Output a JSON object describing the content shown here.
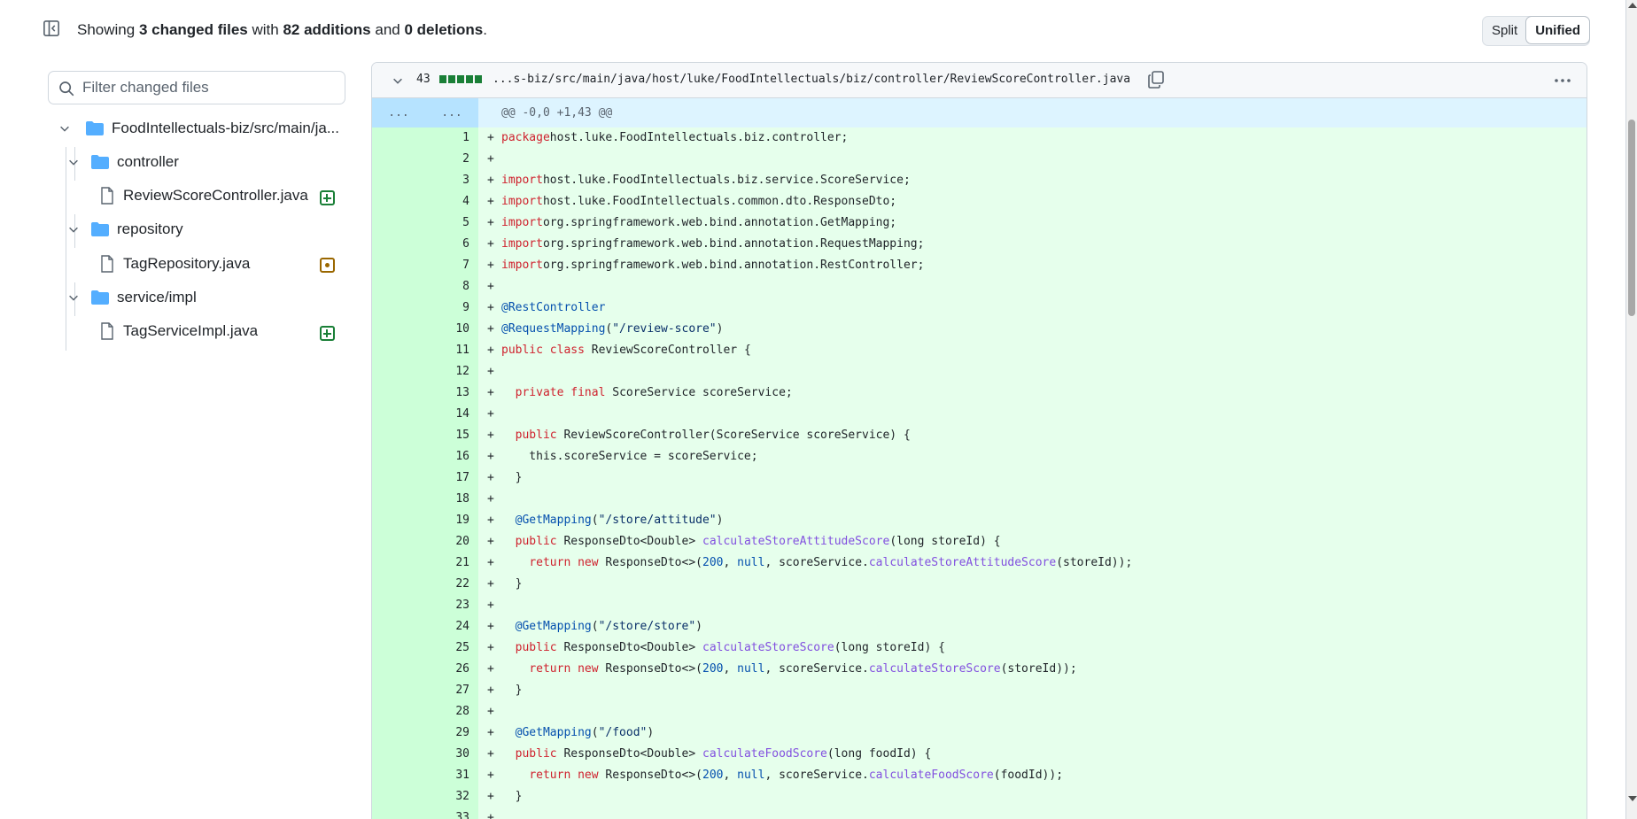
{
  "header": {
    "summary_prefix": "Showing ",
    "files_changed": "3 changed files",
    "summary_with": " with ",
    "additions": "82 additions",
    "summary_and": " and ",
    "deletions": "0 deletions",
    "summary_end": ".",
    "view_split": "Split",
    "view_unified": "Unified",
    "active_view": "Unified"
  },
  "sidebar": {
    "filter_placeholder": "Filter changed files",
    "root_folder": "FoodIntellectuals-biz/src/main/ja...",
    "folders": [
      {
        "name": "controller",
        "files": [
          {
            "name": "ReviewScoreController.java",
            "status": "added"
          }
        ]
      },
      {
        "name": "repository",
        "files": [
          {
            "name": "TagRepository.java",
            "status": "modified"
          }
        ]
      },
      {
        "name": "service/impl",
        "files": [
          {
            "name": "TagServiceImpl.java",
            "status": "added"
          }
        ]
      }
    ]
  },
  "file": {
    "change_count": "43",
    "path": "...s-biz/src/main/java/host/luke/FoodIntellectuals/biz/controller/ReviewScoreController.java",
    "hunk_left": "...",
    "hunk_right": "...",
    "hunk_header": "@@ -0,0 +1,43 @@"
  },
  "code_lines": [
    [
      [
        "k",
        "package"
      ],
      [
        "",
        "host.luke.FoodIntellectuals.biz.controller;"
      ]
    ],
    [],
    [
      [
        "k",
        "import"
      ],
      [
        "",
        "host.luke.FoodIntellectuals.biz.service.ScoreService;"
      ]
    ],
    [
      [
        "k",
        "import"
      ],
      [
        "",
        "host.luke.FoodIntellectuals.common.dto.ResponseDto;"
      ]
    ],
    [
      [
        "k",
        "import"
      ],
      [
        "",
        "org.springframework.web.bind.annotation.GetMapping;"
      ]
    ],
    [
      [
        "k",
        "import"
      ],
      [
        "",
        "org.springframework.web.bind.annotation.RequestMapping;"
      ]
    ],
    [
      [
        "k",
        "import"
      ],
      [
        "",
        "org.springframework.web.bind.annotation.RestController;"
      ]
    ],
    [],
    [
      [
        "a",
        "@RestController"
      ]
    ],
    [
      [
        "a",
        "@RequestMapping"
      ],
      [
        "",
        "("
      ],
      [
        "s",
        "\"/review-score\""
      ],
      [
        "",
        ")"
      ]
    ],
    [
      [
        "k",
        "public"
      ],
      [
        "",
        " "
      ],
      [
        "k",
        "class"
      ],
      [
        "",
        " ReviewScoreController {"
      ]
    ],
    [],
    [
      [
        "",
        "  "
      ],
      [
        "k",
        "private"
      ],
      [
        "",
        " "
      ],
      [
        "k",
        "final"
      ],
      [
        "",
        " ScoreService scoreService;"
      ]
    ],
    [],
    [
      [
        "",
        "  "
      ],
      [
        "k",
        "public"
      ],
      [
        "",
        " ReviewScoreController(ScoreService scoreService) {"
      ]
    ],
    [
      [
        "",
        "    this.scoreService = scoreService;"
      ]
    ],
    [
      [
        "",
        "  }"
      ]
    ],
    [],
    [
      [
        "",
        "  "
      ],
      [
        "a",
        "@GetMapping"
      ],
      [
        "",
        "("
      ],
      [
        "s",
        "\"/store/attitude\""
      ],
      [
        "",
        ")"
      ]
    ],
    [
      [
        "",
        "  "
      ],
      [
        "k",
        "public"
      ],
      [
        "",
        " ResponseDto<Double> "
      ],
      [
        "f",
        "calculateStoreAttitudeScore"
      ],
      [
        "",
        "(long storeId) {"
      ]
    ],
    [
      [
        "",
        "    "
      ],
      [
        "k",
        "return"
      ],
      [
        "",
        " "
      ],
      [
        "k",
        "new"
      ],
      [
        "",
        " ResponseDto<>("
      ],
      [
        "a",
        "200"
      ],
      [
        "",
        ", "
      ],
      [
        "a",
        "null"
      ],
      [
        "",
        ", scoreService."
      ],
      [
        "f",
        "calculateStoreAttitudeScore"
      ],
      [
        "",
        "(storeId));"
      ]
    ],
    [
      [
        "",
        "  }"
      ]
    ],
    [],
    [
      [
        "",
        "  "
      ],
      [
        "a",
        "@GetMapping"
      ],
      [
        "",
        "("
      ],
      [
        "s",
        "\"/store/store\""
      ],
      [
        "",
        ")"
      ]
    ],
    [
      [
        "",
        "  "
      ],
      [
        "k",
        "public"
      ],
      [
        "",
        " ResponseDto<Double> "
      ],
      [
        "f",
        "calculateStoreScore"
      ],
      [
        "",
        "(long storeId) {"
      ]
    ],
    [
      [
        "",
        "    "
      ],
      [
        "k",
        "return"
      ],
      [
        "",
        " "
      ],
      [
        "k",
        "new"
      ],
      [
        "",
        " ResponseDto<>("
      ],
      [
        "a",
        "200"
      ],
      [
        "",
        ", "
      ],
      [
        "a",
        "null"
      ],
      [
        "",
        ", scoreService."
      ],
      [
        "f",
        "calculateStoreScore"
      ],
      [
        "",
        "(storeId));"
      ]
    ],
    [
      [
        "",
        "  }"
      ]
    ],
    [],
    [
      [
        "",
        "  "
      ],
      [
        "a",
        "@GetMapping"
      ],
      [
        "",
        "("
      ],
      [
        "s",
        "\"/food\""
      ],
      [
        "",
        ")"
      ]
    ],
    [
      [
        "",
        "  "
      ],
      [
        "k",
        "public"
      ],
      [
        "",
        " ResponseDto<Double> "
      ],
      [
        "f",
        "calculateFoodScore"
      ],
      [
        "",
        "(long foodId) {"
      ]
    ],
    [
      [
        "",
        "    "
      ],
      [
        "k",
        "return"
      ],
      [
        "",
        " "
      ],
      [
        "k",
        "new"
      ],
      [
        "",
        " ResponseDto<>("
      ],
      [
        "a",
        "200"
      ],
      [
        "",
        ", "
      ],
      [
        "a",
        "null"
      ],
      [
        "",
        ", scoreService."
      ],
      [
        "f",
        "calculateFoodScore"
      ],
      [
        "",
        "(foodId));"
      ]
    ],
    [
      [
        "",
        "  }"
      ]
    ],
    []
  ],
  "colors": {
    "added_gutter": "#ccffd8",
    "added_line": "#e6ffec",
    "hunk_bg": "#ddf4ff",
    "keyword": "#cf222e",
    "annotation": "#0550ae",
    "string": "#0a3069",
    "method": "#8250df",
    "added_badge": "#1a7f37",
    "modified_badge": "#9a6700"
  }
}
